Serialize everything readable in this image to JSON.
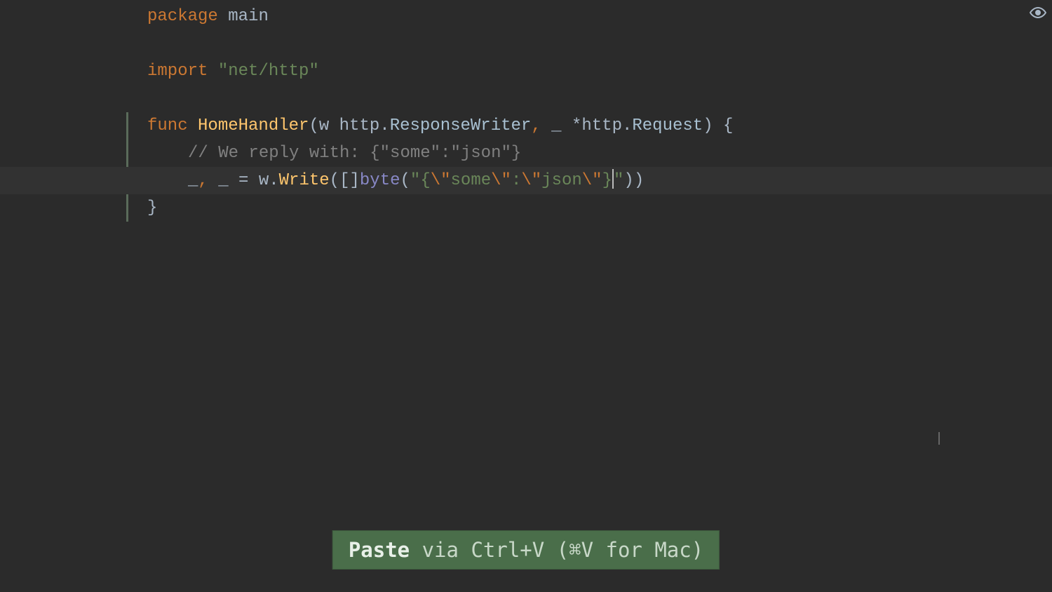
{
  "code": {
    "line1": {
      "kw": "package",
      "sp": " ",
      "name": "main"
    },
    "line3": {
      "kw": "import",
      "sp": " ",
      "str": "\"net/http\""
    },
    "line5": {
      "kw": "func",
      "sp": " ",
      "name": "HomeHandler",
      "open": "(",
      "p1": "w ",
      "pkg1": "http.",
      "t1": "ResponseWriter",
      "comma": ",",
      "sp2": " ",
      "us": "_ ",
      "star": "*",
      "pkg2": "http.",
      "t2": "Request",
      "close": ")",
      "sp3": " ",
      "brace": "{"
    },
    "line6": {
      "comment": "// We reply with: {\"some\":\"json\"}"
    },
    "line7": {
      "lhs": "_",
      "comma1": ",",
      "sp1": " ",
      "lhs2": "_ ",
      "eq": "= ",
      "call1": "w.",
      "meth": "Write",
      "open1": "(",
      "arr": "[]",
      "bt": "byte",
      "open2": "(",
      "q1": "\"",
      "lb": "{",
      "e1": "\\\"",
      "s1": "some",
      "e2": "\\\"",
      "colon": ":",
      "e3": "\\\"",
      "s2": "json",
      "e4": "\\\"",
      "rb": "}",
      "q2": "\"",
      "close2": ")",
      "close1": ")"
    },
    "line8": {
      "brace": "}"
    }
  },
  "toast": {
    "bold": "Paste",
    "rest": " via Ctrl+V (⌘V for Mac)"
  },
  "icons": {
    "eye": "eye"
  }
}
